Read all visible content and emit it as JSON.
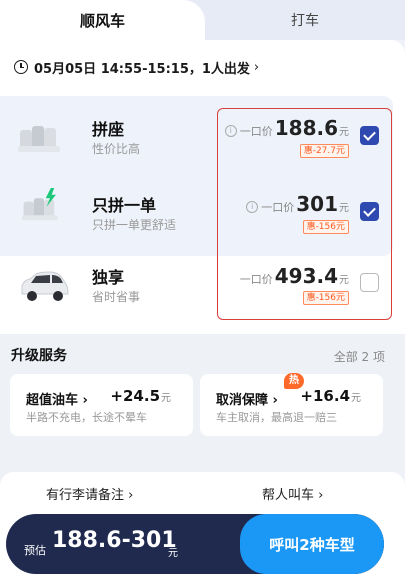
{
  "tabs": {
    "active": "顺风车",
    "other": "打车"
  },
  "trip": {
    "time_text": "05月05日 14:55-15:15，1人出发",
    "arrow": "›"
  },
  "options": [
    {
      "name": "拼座",
      "sub": "性价比高",
      "price_label": "一口价",
      "price": "188.6",
      "unit": "元",
      "discount": "惠-27.7元",
      "selected": true,
      "info_icon": "i"
    },
    {
      "name": "只拼一单",
      "sub": "只拼一单更舒适",
      "price_label": "一口价",
      "price": "301",
      "unit": "元",
      "discount": "惠-156元",
      "selected": true,
      "info_icon": "i"
    },
    {
      "name": "独享",
      "sub": "省时省事",
      "price_label": "一口价",
      "price": "493.4",
      "unit": "元",
      "discount": "惠-156元",
      "selected": false
    }
  ],
  "upgrade": {
    "title": "升级服务",
    "all": "全部 2 项",
    "items": [
      {
        "title": "超值油车 ›",
        "value": "+24.5",
        "unit": "元",
        "desc": "半路不充电，长途不晕车"
      },
      {
        "title": "取消保障 ›",
        "value": "+16.4",
        "unit": "元",
        "desc": "车主取消，最高退一赔三",
        "badge": "热"
      }
    ]
  },
  "links": {
    "luggage": "有行李请备注 ›",
    "help_call": "帮人叫车 ›"
  },
  "footer": {
    "est_label": "预估",
    "range": "188.6-301",
    "yuan": "元",
    "call_button": "呼叫2种车型"
  },
  "colors": {
    "brand_blue": "#1b98f5",
    "dark_bar": "#1f2a4e",
    "check_blue": "#2e4ab0",
    "discount_orange": "#ff5a1f",
    "highlight_red": "#d9403b"
  }
}
